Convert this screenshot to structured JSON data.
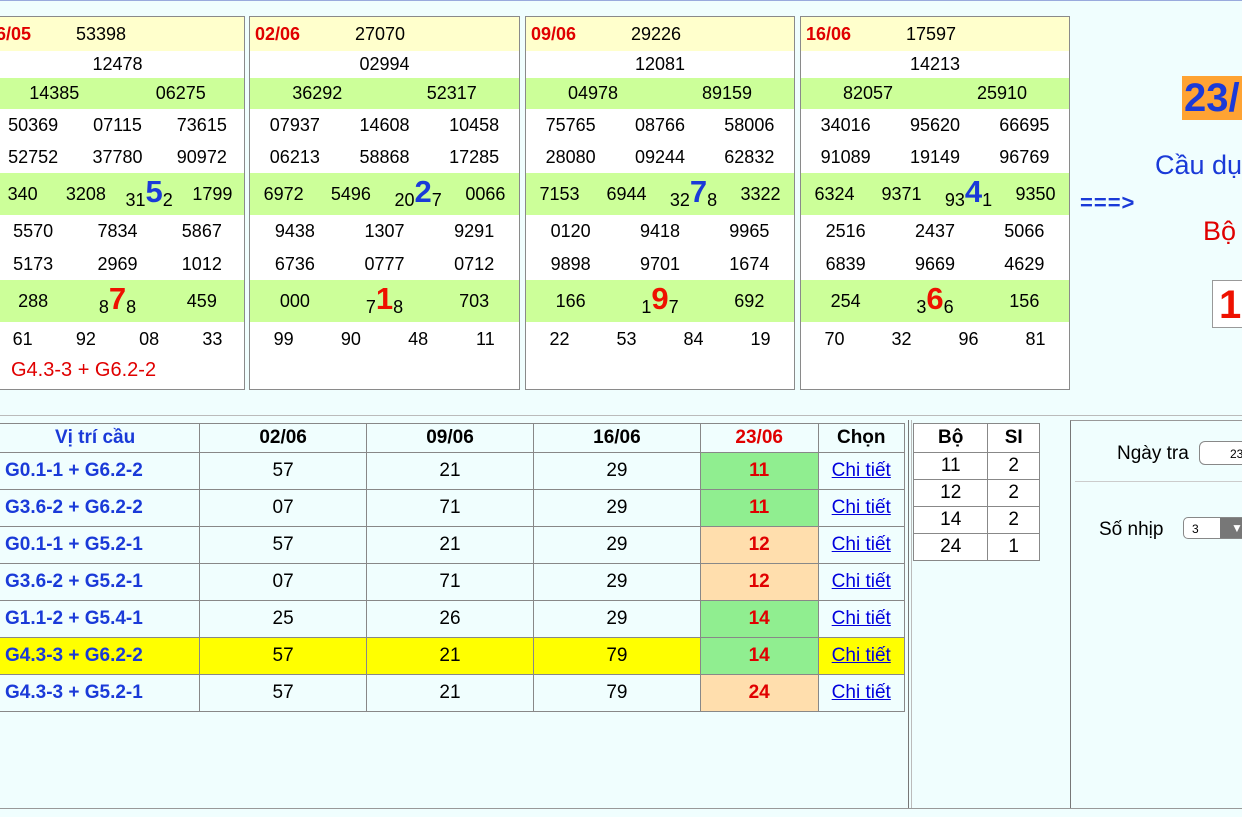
{
  "cards": [
    {
      "date": "6/05",
      "db": "53398",
      "g1": "12478",
      "g2": [
        "14385",
        "06275"
      ],
      "g3a": [
        "50369",
        "07115",
        "73615"
      ],
      "g3b": [
        "52752",
        "37780",
        "90972"
      ],
      "g4": {
        "a": "340",
        "b": "3208",
        "pre": "31",
        "big": "5",
        "post": "2",
        "d": "1799"
      },
      "g5a": [
        "5570",
        "7834",
        "5867"
      ],
      "g5b": [
        "5173",
        "2969",
        "1012"
      ],
      "g6": {
        "a": "288",
        "pre": "8",
        "big": "7",
        "post": "8",
        "c": "459"
      },
      "g7": [
        "61",
        "92",
        "08",
        "33"
      ],
      "footer": "G4.3-3 + G6.2-2"
    },
    {
      "date": "02/06",
      "db": "27070",
      "g1": "02994",
      "g2": [
        "36292",
        "52317"
      ],
      "g3a": [
        "07937",
        "14608",
        "10458"
      ],
      "g3b": [
        "06213",
        "58868",
        "17285"
      ],
      "g4": {
        "a": "6972",
        "b": "5496",
        "pre": "20",
        "big": "2",
        "post": "7",
        "d": "0066"
      },
      "g5a": [
        "9438",
        "1307",
        "9291"
      ],
      "g5b": [
        "6736",
        "0777",
        "0712"
      ],
      "g6": {
        "a": "000",
        "pre": "7",
        "big": "1",
        "post": "8",
        "c": "703"
      },
      "g7": [
        "99",
        "90",
        "48",
        "11"
      ],
      "footer": ""
    },
    {
      "date": "09/06",
      "db": "29226",
      "g1": "12081",
      "g2": [
        "04978",
        "89159"
      ],
      "g3a": [
        "75765",
        "08766",
        "58006"
      ],
      "g3b": [
        "28080",
        "09244",
        "62832"
      ],
      "g4": {
        "a": "7153",
        "b": "6944",
        "pre": "32",
        "big": "7",
        "post": "8",
        "d": "3322"
      },
      "g5a": [
        "0120",
        "9418",
        "9965"
      ],
      "g5b": [
        "9898",
        "9701",
        "1674"
      ],
      "g6": {
        "a": "166",
        "pre": "1",
        "big": "9",
        "post": "7",
        "c": "692"
      },
      "g7": [
        "22",
        "53",
        "84",
        "19"
      ],
      "footer": ""
    },
    {
      "date": "16/06",
      "db": "17597",
      "g1": "14213",
      "g2": [
        "82057",
        "25910"
      ],
      "g3a": [
        "34016",
        "95620",
        "66695"
      ],
      "g3b": [
        "91089",
        "19149",
        "96769"
      ],
      "g4": {
        "a": "6324",
        "b": "9371",
        "pre": "93",
        "big": "4",
        "post": "1",
        "d": "9350"
      },
      "g5a": [
        "2516",
        "2437",
        "5066"
      ],
      "g5b": [
        "6839",
        "9669",
        "4629"
      ],
      "g6": {
        "a": "254",
        "pre": "3",
        "big": "6",
        "post": "6",
        "c": "156"
      },
      "g7": [
        "70",
        "32",
        "96",
        "81"
      ],
      "footer": ""
    }
  ],
  "arrow": "===>",
  "target_date": "23/",
  "cau_dung_label": "Cầu dụ",
  "bo_label": "Bộ",
  "bo_value": "1",
  "table": {
    "headers": [
      "Vị trí cầu",
      "02/06",
      "09/06",
      "16/06",
      "23/06",
      "Chọn"
    ],
    "link_label": "Chi tiết",
    "rows": [
      {
        "pos": "G0.1-1 + G6.2-2",
        "v1": "57",
        "v2": "21",
        "v3": "29",
        "res": "11",
        "res_color": "green",
        "highlight": false
      },
      {
        "pos": "G3.6-2 + G6.2-2",
        "v1": "07",
        "v2": "71",
        "v3": "29",
        "res": "11",
        "res_color": "green",
        "highlight": false
      },
      {
        "pos": "G0.1-1 + G5.2-1",
        "v1": "57",
        "v2": "21",
        "v3": "29",
        "res": "12",
        "res_color": "orange",
        "highlight": false
      },
      {
        "pos": "G3.6-2 + G5.2-1",
        "v1": "07",
        "v2": "71",
        "v3": "29",
        "res": "12",
        "res_color": "orange",
        "highlight": false
      },
      {
        "pos": "G1.1-2 + G5.4-1",
        "v1": "25",
        "v2": "26",
        "v3": "29",
        "res": "14",
        "res_color": "green",
        "highlight": false
      },
      {
        "pos": "G4.3-3 + G6.2-2",
        "v1": "57",
        "v2": "21",
        "v3": "79",
        "res": "14",
        "res_color": "green",
        "highlight": true
      },
      {
        "pos": "G4.3-3 + G5.2-1",
        "v1": "57",
        "v2": "21",
        "v3": "79",
        "res": "24",
        "res_color": "orange",
        "highlight": false
      }
    ]
  },
  "bo_table": {
    "headers": [
      "Bộ",
      "SI"
    ],
    "rows": [
      [
        "11",
        "2"
      ],
      [
        "12",
        "2"
      ],
      [
        "14",
        "2"
      ],
      [
        "24",
        "1"
      ]
    ]
  },
  "panel": {
    "ngay_tra_label": "Ngày tra",
    "ngay_tra_value": "23",
    "so_nhip_label": "Số nhịp",
    "so_nhip_value": "3",
    "dropdown_arrow": "▼"
  },
  "colors": {
    "accent_blue": "#1a3ad8",
    "red": "#e00000",
    "highlight": "#ffff00",
    "green_cell": "#90ee90",
    "orange_cell": "#ffdead"
  }
}
